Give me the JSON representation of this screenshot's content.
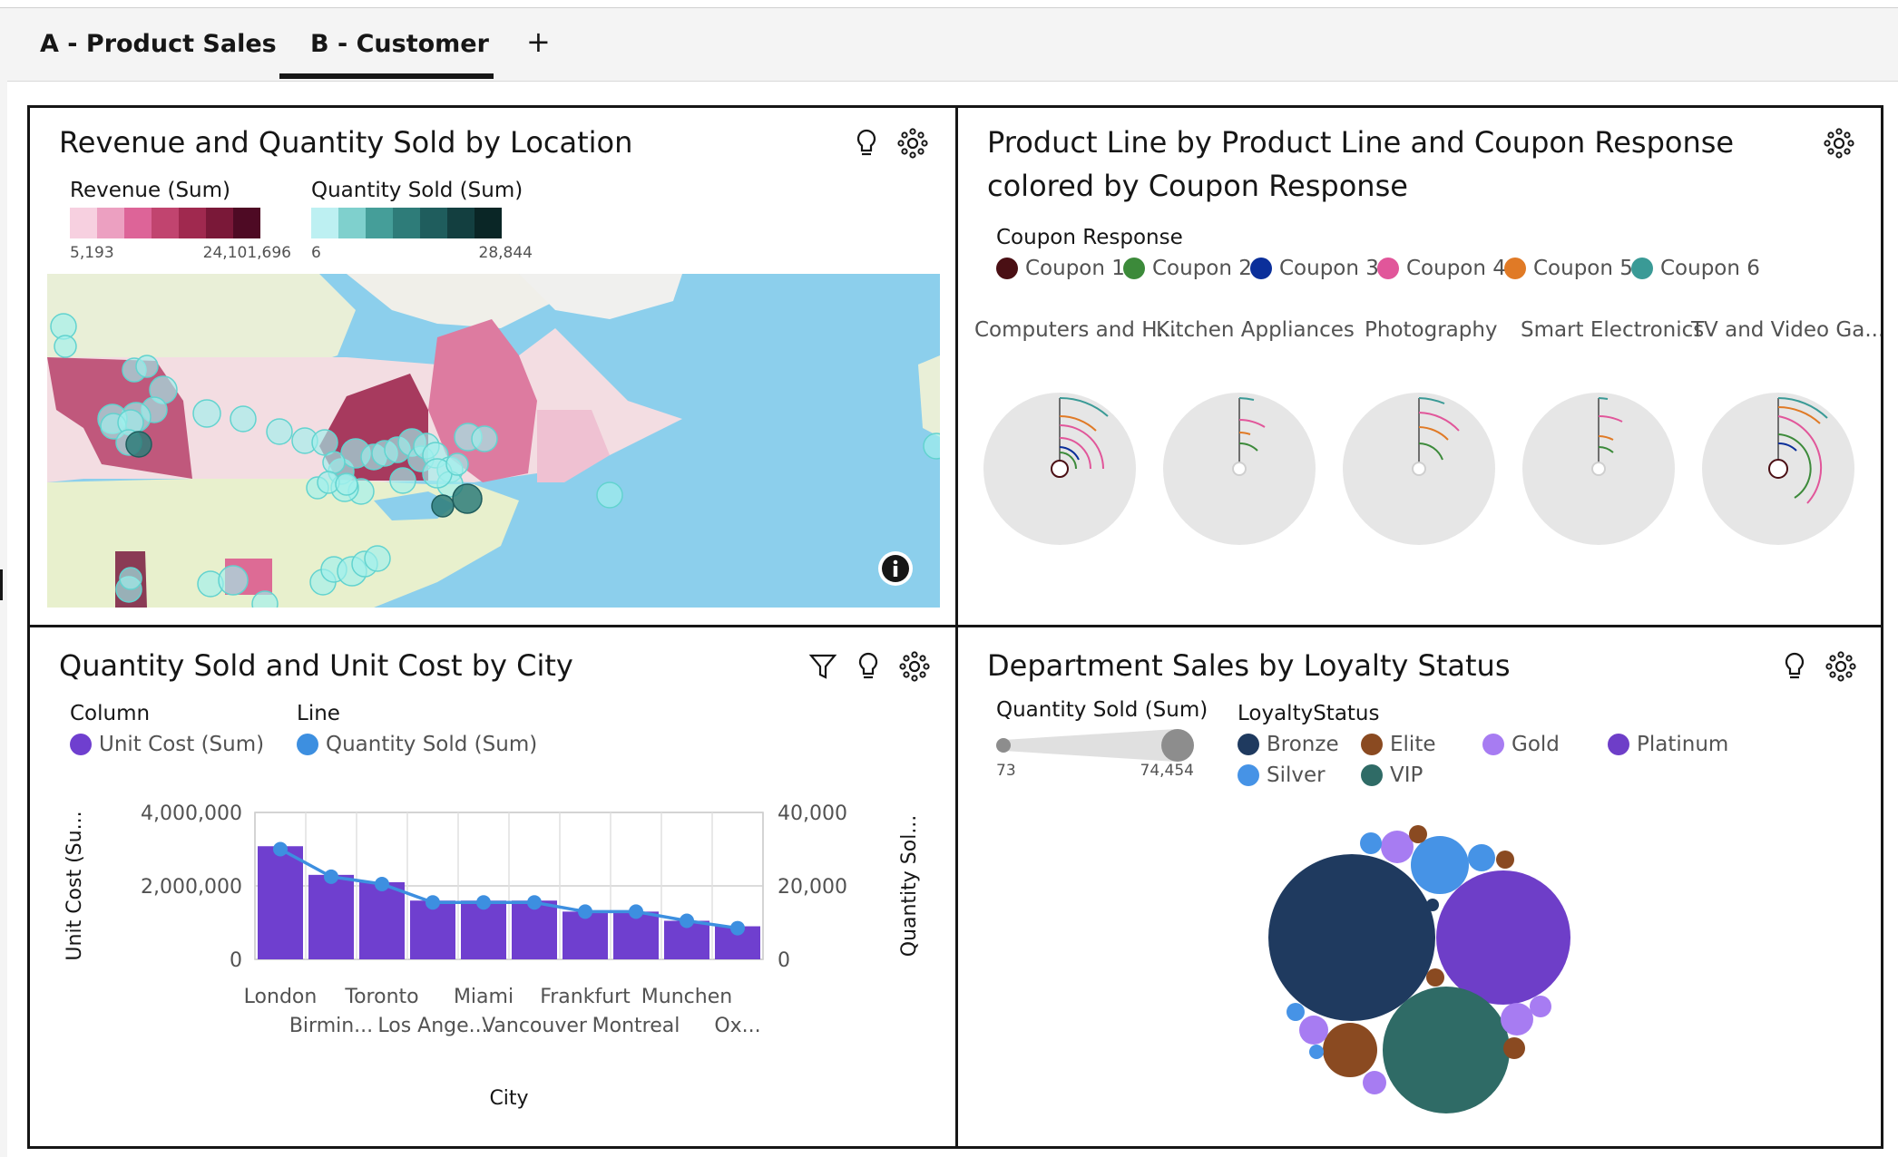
{
  "tabs": [
    {
      "label": "A - Product Sales",
      "active": false
    },
    {
      "label": "B - Customer",
      "active": true
    }
  ],
  "add_tab_label": "+",
  "map_panel": {
    "title": "Revenue and Quantity Sold by Location",
    "revenue_legend": {
      "title": "Revenue (Sum)",
      "min": "5,193",
      "max": "24,101,696",
      "colors": [
        "#f7d0e0",
        "#eca0c1",
        "#dd6498",
        "#c1446f",
        "#a0294f",
        "#7a1838",
        "#4e0a24"
      ]
    },
    "quantity_legend": {
      "title": "Quantity Sold (Sum)",
      "min": "6",
      "max": "28,844",
      "colors": [
        "#bdf0f2",
        "#7fd0cd",
        "#459e99",
        "#2e7c79",
        "#1f5d5d",
        "#133f40",
        "#0a2626"
      ]
    },
    "info_icon": "info-icon"
  },
  "facet_panel": {
    "title": "Product Line by Product Line and Coupon Response colored by Coupon Response",
    "legend_title": "Coupon Response",
    "legend": [
      {
        "label": "Coupon 1",
        "color": "#4a0f14"
      },
      {
        "label": "Coupon 2",
        "color": "#3c8a3a"
      },
      {
        "label": "Coupon 3",
        "color": "#0b2f9a"
      },
      {
        "label": "Coupon 4",
        "color": "#e1569a"
      },
      {
        "label": "Coupon 5",
        "color": "#e07a26"
      },
      {
        "label": "Coupon 6",
        "color": "#3a9a96"
      }
    ],
    "facets": [
      "Computers and H...",
      "Kitchen Appliances",
      "Photography",
      "Smart Electronics",
      "TV and Video Ga..."
    ]
  },
  "combo_panel": {
    "title": "Quantity Sold and Unit Cost by City",
    "legend_column_title": "Column",
    "legend_line_title": "Line",
    "column_series_label": "Unit Cost (Sum)",
    "line_series_label": "Quantity Sold (Sum)",
    "column_color": "#6f3fcf",
    "line_color": "#3d8fe0",
    "y_left_label": "Unit Cost (Su...",
    "y_right_label": "Quantity Sol...",
    "x_label": "City",
    "y_left_ticks": [
      "4,000,000",
      "2,000,000",
      "0"
    ],
    "y_right_ticks": [
      "40,000",
      "20,000",
      "0"
    ]
  },
  "bubble_panel": {
    "title": "Department Sales by Loyalty Status",
    "size_legend_title": "Quantity Sold (Sum)",
    "size_min": "73",
    "size_max": "74,454",
    "legend_title": "LoyaltyStatus",
    "legend": [
      {
        "label": "Bronze",
        "color": "#1f3a5f"
      },
      {
        "label": "Elite",
        "color": "#8a4a21"
      },
      {
        "label": "Gold",
        "color": "#a77cf2"
      },
      {
        "label": "Platinum",
        "color": "#6e3ec8"
      },
      {
        "label": "Silver",
        "color": "#4693e6"
      },
      {
        "label": "VIP",
        "color": "#2f6b66"
      }
    ]
  },
  "chart_data": [
    {
      "type": "bar",
      "title": "Quantity Sold and Unit Cost by City",
      "xlabel": "City",
      "categories": [
        "London",
        "Birmin...",
        "Toronto",
        "Los Ange...",
        "Miami",
        "Vancouver",
        "Frankfurt",
        "Montreal",
        "Munchen",
        "Ox..."
      ],
      "series": [
        {
          "name": "Unit Cost (Sum)",
          "type": "bar",
          "axis": "left",
          "values": [
            3080000,
            2300000,
            2100000,
            1600000,
            1600000,
            1600000,
            1300000,
            1300000,
            1050000,
            900000
          ]
        },
        {
          "name": "Quantity Sold (Sum)",
          "type": "line",
          "axis": "right",
          "values": [
            30000,
            22500,
            20500,
            15500,
            15500,
            15500,
            13000,
            13000,
            10500,
            8500
          ]
        }
      ],
      "ylabel": "Unit Cost (Su...",
      "ylim": [
        0,
        4000000
      ],
      "y2label": "Quantity Sol...",
      "y2lim": [
        0,
        40000
      ],
      "grid": true,
      "legend": "top-left"
    }
  ]
}
